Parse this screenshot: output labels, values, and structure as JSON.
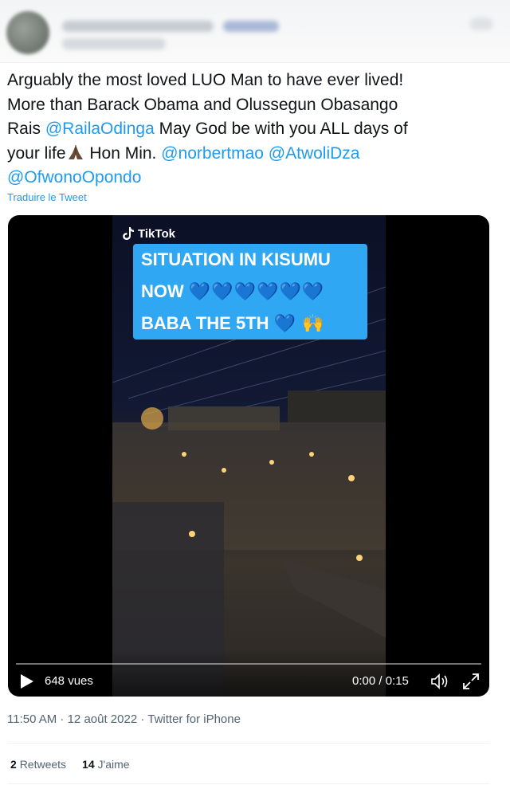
{
  "tweet": {
    "line1": "Arguably the most loved LUO Man to have ever lived!",
    "line2": "More than Barack Obama and Olussegun Obasango",
    "line3_pre": "Rais ",
    "mention1": "@RailaOdinga",
    "line3_post": " May God be with you ALL days of",
    "line4_pre": "your life",
    "emoji": "folded-hands-emoji",
    "line4_mid": " Hon Min. ",
    "mention2": "@norbertmao",
    "mention3": "@AtwoliDza",
    "mention4": "@OfwonoOpondo",
    "translate": "Traduire le Tweet"
  },
  "video": {
    "brand": "TikTok",
    "caption_line1": "SITUATION IN KISUMU",
    "caption_line2": "NOW",
    "caption_line2_hearts": "💙💙💙💙💙💙",
    "caption_line3": "BABA THE 5TH",
    "caption_line3_extra": "💙 🙌",
    "views": "648 vues",
    "time": "0:00 / 0:15",
    "progress": 0
  },
  "meta": {
    "timestamp": "11:50 AM · 12 août 2022 · Twitter for iPhone"
  },
  "stats": {
    "retweets_count": "2",
    "retweets_label": "Retweets",
    "likes_count": "14",
    "likes_label": "J'aime"
  },
  "colors": {
    "link": "#1d9bf0",
    "caption_bg": "#2fa7f3",
    "secondary_text": "#536471"
  }
}
